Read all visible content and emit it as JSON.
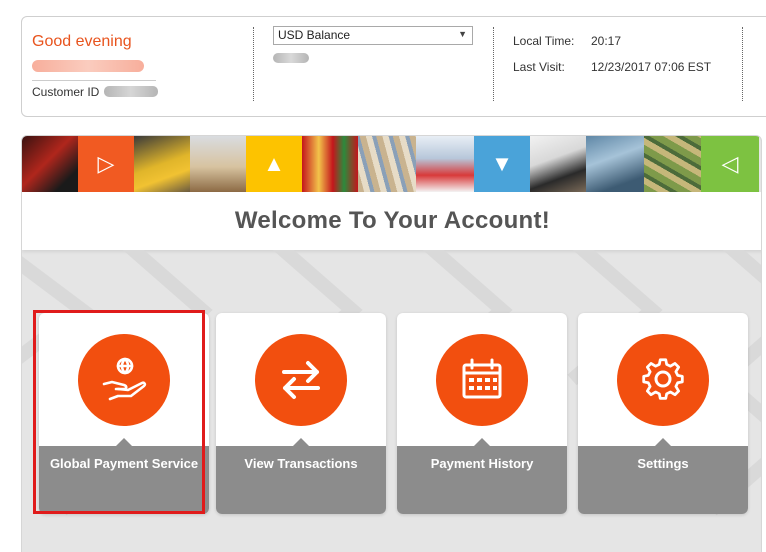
{
  "header": {
    "greeting": "Good evening",
    "customer_id_label": "Customer ID",
    "balance_select": {
      "selected": "USD Balance"
    },
    "local_time_label": "Local Time:",
    "local_time_value": "20:17",
    "last_visit_label": "Last Visit:",
    "last_visit_value": "12/23/2017 07:06 EST"
  },
  "welcome": {
    "title": "Welcome To Your Account!"
  },
  "tiles": [
    {
      "label": "Global Payment Service",
      "icon": "hand-globe-icon"
    },
    {
      "label": "View Transactions",
      "icon": "swap-arrows-icon"
    },
    {
      "label": "Payment History",
      "icon": "calendar-icon"
    },
    {
      "label": "Settings",
      "icon": "gear-icon"
    }
  ],
  "colors": {
    "accent": "#f24f0f",
    "greeting": "#e8541e",
    "tile_footer": "#8c8c8c",
    "highlight": "#e01b1b",
    "banner_orange": "#f15a22",
    "banner_yellow": "#fdc300",
    "banner_blue": "#4aa3d9",
    "banner_green": "#7dc241"
  }
}
